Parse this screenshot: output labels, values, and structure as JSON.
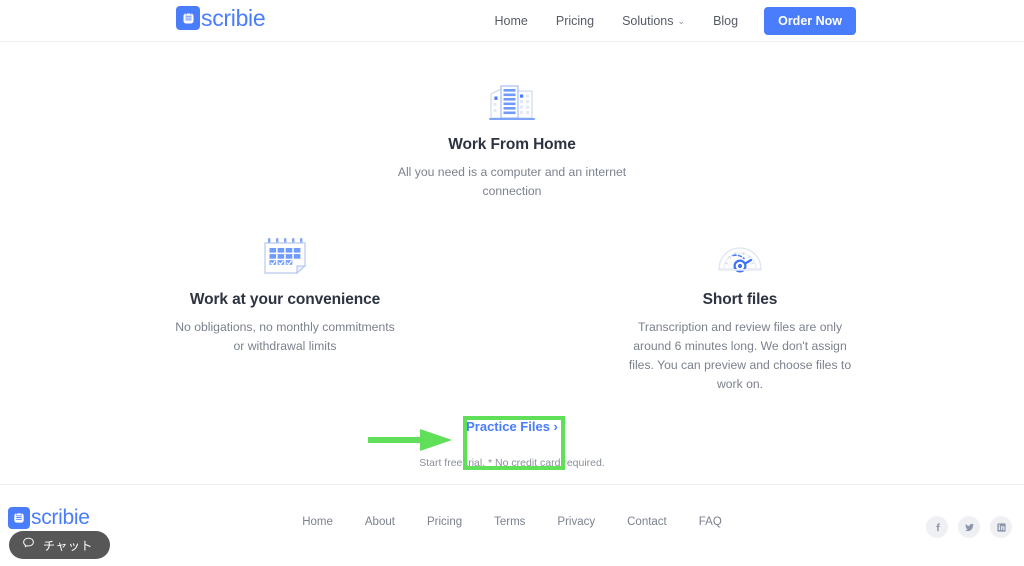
{
  "header": {
    "brand": {
      "name": "scribie",
      "icon": "scribie-logo-icon"
    },
    "nav": [
      {
        "label": "Home",
        "name": "nav-home"
      },
      {
        "label": "Pricing",
        "name": "nav-pricing"
      },
      {
        "label": "Solutions",
        "name": "nav-solutions",
        "caret": "⌄"
      },
      {
        "label": "Blog",
        "name": "nav-blog"
      }
    ],
    "order_button": "Order Now"
  },
  "features": [
    {
      "id": "work-from-home",
      "icon": "office-buildings-icon",
      "title": "Work From Home",
      "desc": "All you need is a computer and an internet connection"
    },
    {
      "id": "work-at-your-convenience",
      "icon": "calendar-icon",
      "title": "Work at your convenience",
      "desc": "No obligations, no monthly commitments or withdrawal limits"
    },
    {
      "id": "short-files",
      "icon": "speedometer-icon",
      "title": "Short files",
      "desc": "Transcription and review files are only around 6 minutes long. We don't assign files. You can preview and choose files to work on."
    }
  ],
  "cta": {
    "link_label": "Practice Files ›",
    "note": "Start free trial. * No credit card required."
  },
  "annotations": {
    "highlight_color": "#5fe058",
    "arrow_color": "#5fe058"
  },
  "footer": {
    "brand": {
      "name": "scribie",
      "icon": "scribie-logo-icon"
    },
    "links": [
      {
        "label": "Home",
        "name": "footer-home"
      },
      {
        "label": "About",
        "name": "footer-about"
      },
      {
        "label": "Pricing",
        "name": "footer-pricing"
      },
      {
        "label": "Terms",
        "name": "footer-terms"
      },
      {
        "label": "Privacy",
        "name": "footer-privacy"
      },
      {
        "label": "Contact",
        "name": "footer-contact"
      },
      {
        "label": "FAQ",
        "name": "footer-faq"
      }
    ],
    "social": [
      {
        "name": "facebook-icon",
        "glyph": "f"
      },
      {
        "name": "twitter-icon",
        "glyph": "t"
      },
      {
        "name": "linkedin-icon",
        "glyph": "in"
      }
    ]
  },
  "chat": {
    "label": "チャット",
    "icon": "chat-bubble-icon"
  },
  "colors": {
    "brand_blue": "#4a7dfc",
    "text_dark": "#2d3340",
    "text_muted": "#7b818d",
    "annotation_green": "#5fe058",
    "chat_bg": "#575757"
  }
}
